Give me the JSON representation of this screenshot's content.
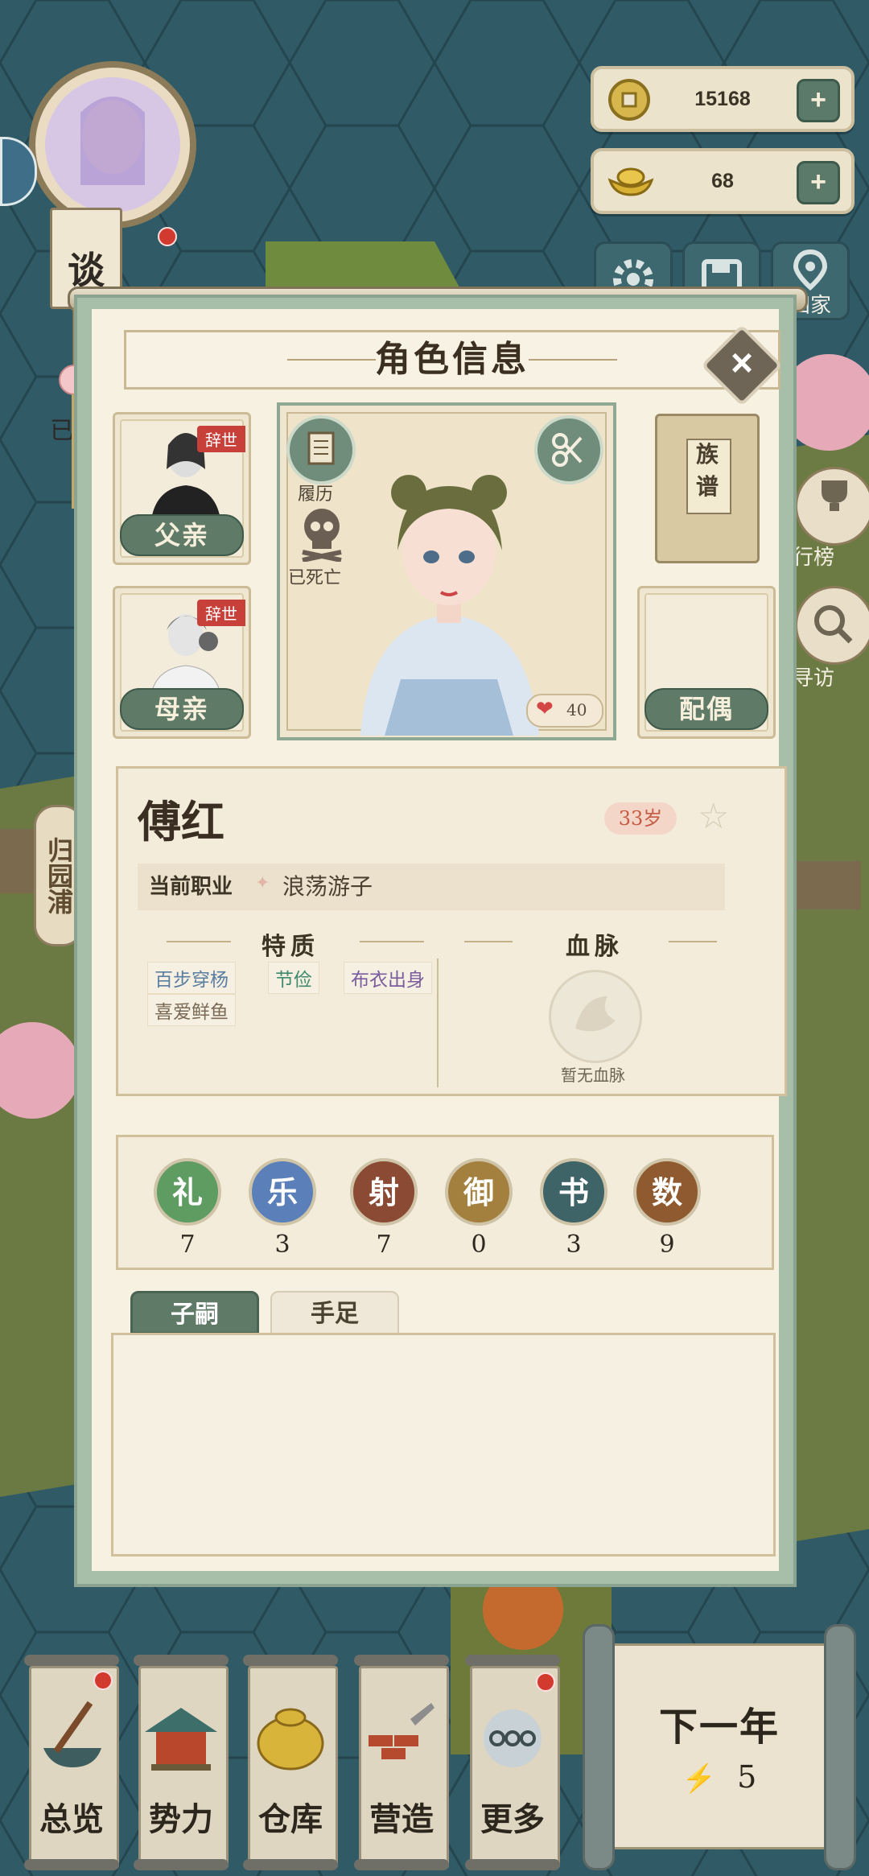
{
  "hud": {
    "coins": "15168",
    "ingots": "68",
    "plus": "+",
    "home_label": "归家",
    "talk_label": "谈",
    "left_status": "已",
    "side_label": "归园浦",
    "rank_label": "行榜",
    "visit_label": "寻访"
  },
  "modal": {
    "title": "角色信息",
    "close": "×",
    "father": {
      "label": "父亲",
      "badge": "辞世"
    },
    "mother": {
      "label": "母亲",
      "badge": "辞世"
    },
    "resume_label": "履历",
    "dead_label": "已死亡",
    "affection": "40",
    "lineage_label": "族谱",
    "spouse_label": "配偶",
    "character": {
      "name": "傅红",
      "age": "33岁",
      "job_label": "当前职业",
      "job_value": "浪荡游子"
    },
    "traits_title": "特质",
    "traits": [
      {
        "text": "百步穿杨",
        "color": "#5a7da0"
      },
      {
        "text": "节俭",
        "color": "#3f8a6d"
      },
      {
        "text": "布衣出身",
        "color": "#7a5c9e"
      },
      {
        "text": "喜爱鲜鱼",
        "color": "#7a6a55"
      }
    ],
    "blood_title": "血脉",
    "blood_none": "暂无血脉",
    "stats": [
      {
        "label": "礼",
        "value": "7",
        "color": "#5f9c62"
      },
      {
        "label": "乐",
        "value": "3",
        "color": "#5b7fb8"
      },
      {
        "label": "射",
        "value": "7",
        "color": "#8a4a34"
      },
      {
        "label": "御",
        "value": "0",
        "color": "#a4803e"
      },
      {
        "label": "书",
        "value": "3",
        "color": "#3f6468"
      },
      {
        "label": "数",
        "value": "9",
        "color": "#8f5a30"
      }
    ],
    "tabs": [
      "子嗣",
      "手足"
    ]
  },
  "nav": {
    "items": [
      "总览",
      "势力",
      "仓库",
      "营造",
      "更多"
    ],
    "next_year": "下一年",
    "energy": "5"
  },
  "colors": {
    "accent_green": "#607a68",
    "paper": "#f7f1e2",
    "badge_red": "#c8403a"
  }
}
